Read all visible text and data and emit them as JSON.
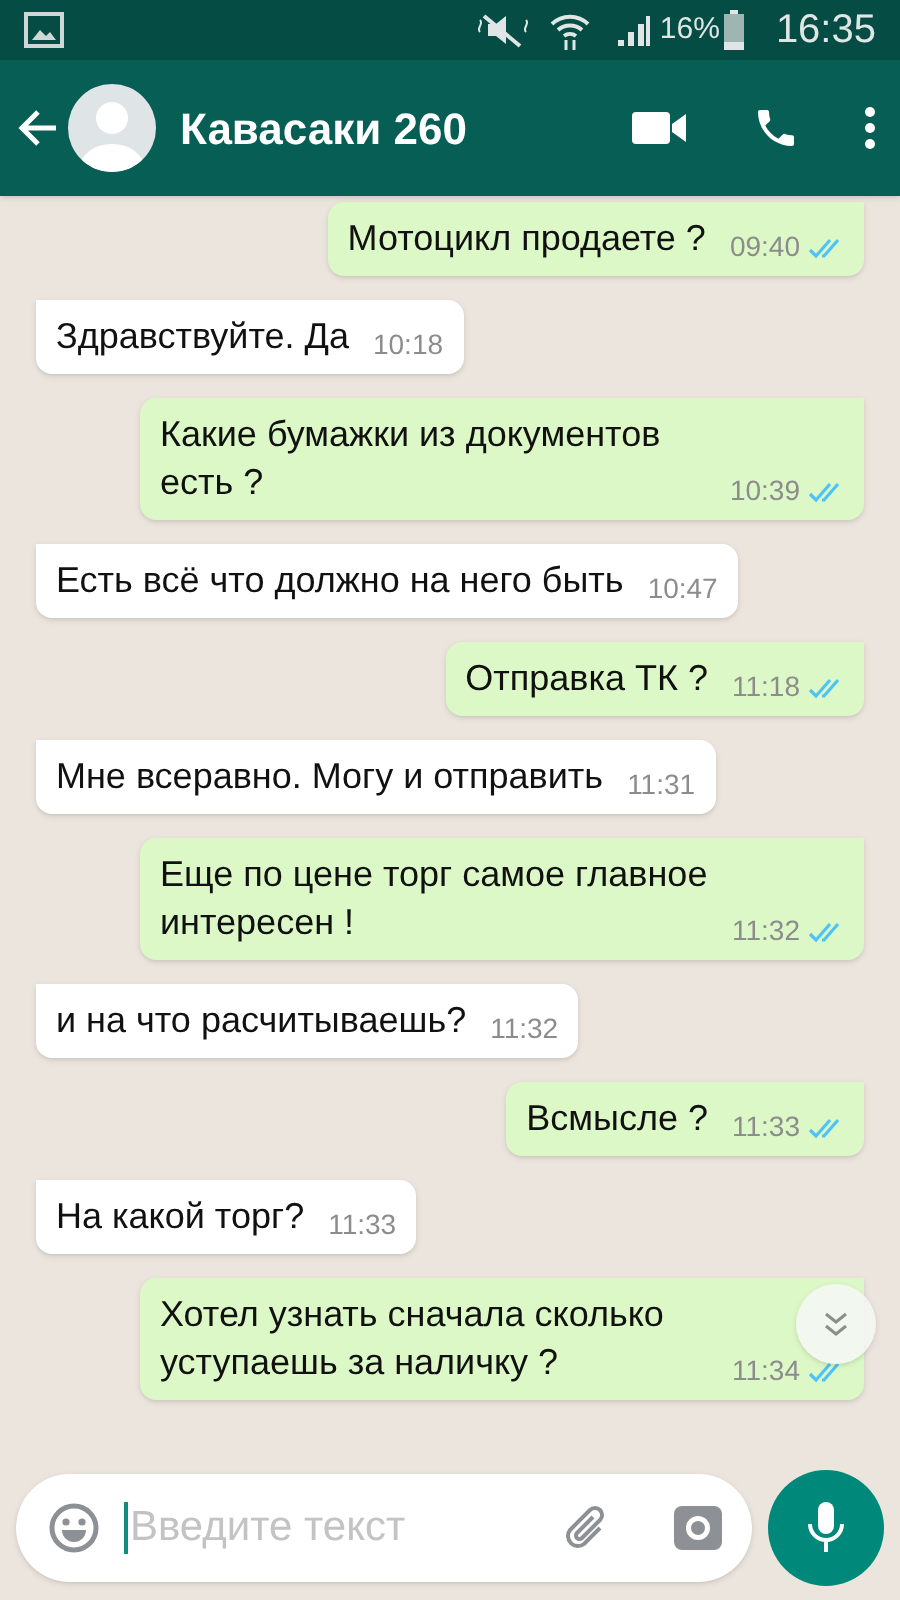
{
  "status_bar": {
    "battery": "16%",
    "time": "16:35"
  },
  "header": {
    "title": "Кавасаки 260"
  },
  "messages": [
    {
      "kind": "out",
      "text": "Мотоцикл продаете ?",
      "time": "09:40",
      "read": true
    },
    {
      "kind": "in",
      "text": "Здравствуйте. Да",
      "time": "10:18"
    },
    {
      "kind": "out",
      "text": "Какие бумажки из документов есть ?",
      "time": "10:39",
      "read": true
    },
    {
      "kind": "in",
      "text": "Есть всё что должно на него быть",
      "time": "10:47"
    },
    {
      "kind": "out",
      "text": "Отправка ТК ?",
      "time": "11:18",
      "read": true
    },
    {
      "kind": "in",
      "text": "Мне всеравно. Могу и отправить",
      "time": "11:31"
    },
    {
      "kind": "out",
      "text": "Еще по цене торг самое главное интересен !",
      "time": "11:32",
      "read": true
    },
    {
      "kind": "in",
      "text": "и на что расчитываешь?",
      "time": "11:32"
    },
    {
      "kind": "out",
      "text": "Всмысле ?",
      "time": "11:33",
      "read": true
    },
    {
      "kind": "in",
      "text": "На какой торг?",
      "time": "11:33"
    },
    {
      "kind": "out",
      "text": "Хотел узнать сначала сколько уступаешь за наличку ?",
      "time": "11:34",
      "read": true
    }
  ],
  "composer": {
    "placeholder": "Введите текст"
  }
}
